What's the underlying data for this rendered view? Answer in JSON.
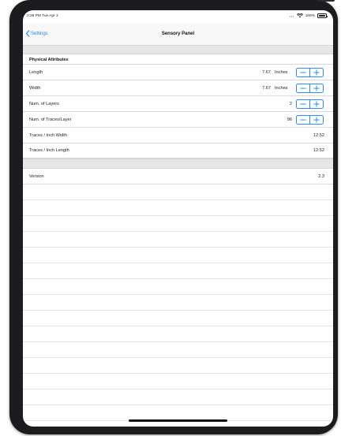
{
  "status_bar": {
    "time": "2:28 PM  Tue Apr 2",
    "signal_dots": "•••",
    "battery": "100%"
  },
  "nav": {
    "back_label": "Settings",
    "title": "Sensory Panel"
  },
  "physical": {
    "header": "Physical Attributes",
    "rows": [
      {
        "label": "Length",
        "value": "7.67",
        "unit": "Inches"
      },
      {
        "label": "Width",
        "value": "7.67",
        "unit": "Inches"
      },
      {
        "label": "Num. of Layers",
        "value": "2"
      },
      {
        "label": "Num. of Traces/Layer",
        "value": "96"
      },
      {
        "label": "Traces / Inch Width",
        "value": "12.52"
      },
      {
        "label": "Traces / Inch Length",
        "value": "12.52"
      }
    ]
  },
  "info": {
    "version_label": "Version",
    "version_value": "2.3"
  },
  "colors": {
    "accent": "#1e88f0",
    "group_bg": "#e6e6e6",
    "device": "#1c1c1e"
  }
}
